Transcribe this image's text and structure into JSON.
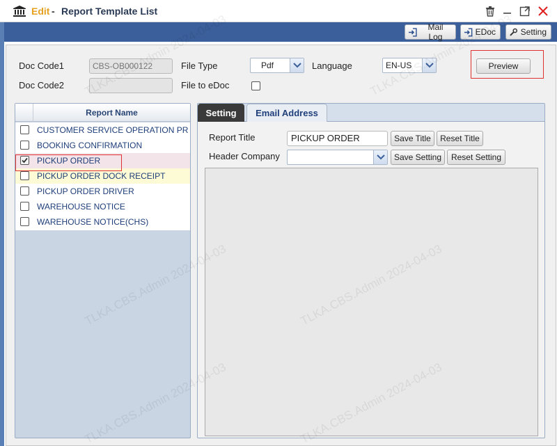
{
  "window": {
    "mode": "Edit",
    "separator": "-",
    "title": "Report Template List"
  },
  "toolbar": {
    "mail_log": "Mail Log",
    "edoc": "EDoc",
    "setting": "Setting"
  },
  "form": {
    "doc_code1_label": "Doc Code1",
    "doc_code1_value": "CBS-OB000122",
    "doc_code2_label": "Doc Code2",
    "doc_code2_value": "",
    "file_type_label": "File Type",
    "file_type_value": "Pdf",
    "file_to_edoc_label": "File to eDoc",
    "language_label": "Language",
    "language_value": "EN-US",
    "preview_button": "Preview"
  },
  "report_list": {
    "header": "Report Name",
    "rows": [
      {
        "name": "CUSTOMER SERVICE OPERATION PRE-ALERT",
        "checked": false
      },
      {
        "name": "BOOKING CONFIRMATION",
        "checked": false
      },
      {
        "name": "PICKUP ORDER",
        "checked": true
      },
      {
        "name": "PICKUP ORDER DOCK RECEIPT",
        "checked": false
      },
      {
        "name": "PICKUP ORDER DRIVER",
        "checked": false
      },
      {
        "name": "WAREHOUSE NOTICE",
        "checked": false
      },
      {
        "name": "WAREHOUSE NOTICE(CHS)",
        "checked": false
      }
    ]
  },
  "tabs": {
    "setting": "Setting",
    "email_address": "Email Address"
  },
  "setting": {
    "report_title_label": "Report Title",
    "report_title_value": "PICKUP ORDER",
    "save_title": "Save Title",
    "reset_title": "Reset Title",
    "header_company_label": "Header Company",
    "header_company_value": "",
    "save_setting": "Save Setting",
    "reset_setting": "Reset Setting"
  },
  "watermark": "TLKA.CBS.Admin 2024-04-03",
  "colors": {
    "toolbar": "#3b5f9a",
    "edit_accent": "#e8a020",
    "close": "#e02020",
    "selected_row": "#f2e4e8",
    "hover_row": "#fdfbd5",
    "highlight_box": "#e03030"
  }
}
